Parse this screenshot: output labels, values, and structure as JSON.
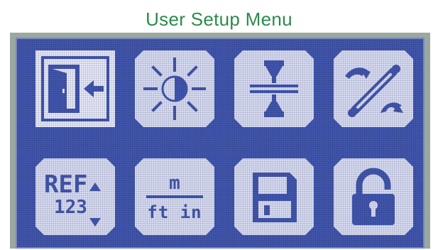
{
  "page": {
    "title": "User Setup Menu"
  },
  "menu": {
    "items": [
      {
        "id": "exit",
        "icon": "exit-door-icon",
        "selected": true
      },
      {
        "id": "brightness",
        "icon": "brightness-icon",
        "selected": false
      },
      {
        "id": "calibration",
        "icon": "calibration-icon",
        "selected": false
      },
      {
        "id": "tools",
        "icon": "wrench-icon",
        "selected": false
      },
      {
        "id": "reference",
        "icon": "reference-icon",
        "selected": false,
        "label_top": "REF",
        "label_bottom": "123"
      },
      {
        "id": "units",
        "icon": "units-icon",
        "selected": false,
        "label_top": "m",
        "label_bottom": "ft in"
      },
      {
        "id": "save",
        "icon": "floppy-disk-icon",
        "selected": false
      },
      {
        "id": "unlock",
        "icon": "unlocked-padlock-icon",
        "selected": false
      }
    ]
  },
  "colors": {
    "lcd_background": "#4257ad",
    "tile": "#d8dcf2",
    "title": "#2c8a4c"
  }
}
